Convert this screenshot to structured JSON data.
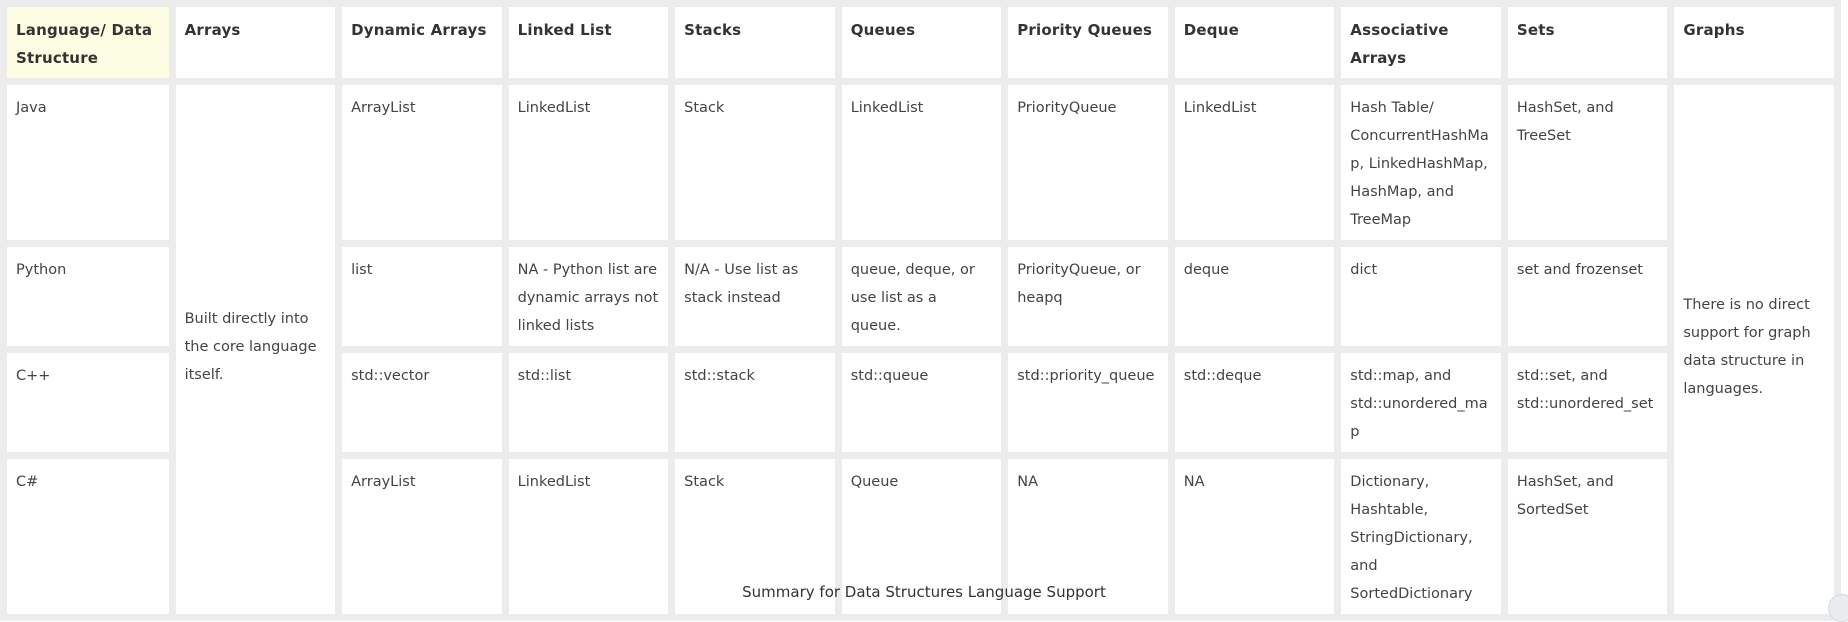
{
  "table": {
    "headers": [
      "Language/ Data Structure",
      "Arrays",
      "Dynamic Arrays",
      "Linked List",
      "Stacks",
      "Queues",
      "Priority Queues",
      "Deque",
      "Associative Arrays",
      "Sets",
      "Graphs"
    ],
    "arrays_all": "Built directly into the core language itself.",
    "graphs_all": "There is no direct support for graph data structure in languages.",
    "rows": [
      {
        "language": "Java",
        "dynamic_arrays": "ArrayList",
        "linked_list": "LinkedList",
        "stacks": "Stack",
        "queues": "LinkedList",
        "priority_queues": "PriorityQueue",
        "deque": "LinkedList",
        "associative_arrays": "Hash Table/ ConcurrentHashMap, LinkedHashMap, HashMap, and TreeMap",
        "sets": "HashSet, and TreeSet"
      },
      {
        "language": "Python",
        "dynamic_arrays": "list",
        "linked_list": "NA - Python list are dynamic arrays not linked lists",
        "stacks": "N/A - Use list as stack instead",
        "queues": "queue, deque, or use list as a queue.",
        "priority_queues": "PriorityQueue, or heapq",
        "deque": "deque",
        "associative_arrays": "dict",
        "sets": "set and frozenset"
      },
      {
        "language": "C++",
        "dynamic_arrays": "std::vector",
        "linked_list": "std::list",
        "stacks": "std::stack",
        "queues": "std::queue",
        "priority_queues": "std::priority_queue",
        "deque": "std::deque",
        "associative_arrays": "std::map, and std::unordered_map",
        "sets": "std::set, and std::unordered_set"
      },
      {
        "language": "C#",
        "dynamic_arrays": "ArrayList",
        "linked_list": "LinkedList",
        "stacks": "Stack",
        "queues": "Queue",
        "priority_queues": "NA",
        "deque": "NA",
        "associative_arrays": "Dictionary, Hashtable, StringDictionary, and SortedDictionary",
        "sets": "HashSet, and SortedSet"
      }
    ]
  },
  "caption": "Summary for Data Structures Language Support"
}
